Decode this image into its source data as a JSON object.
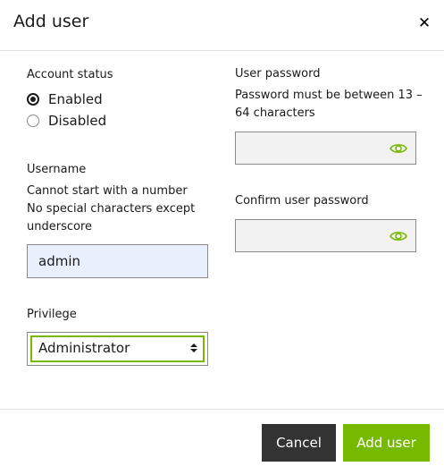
{
  "dialog": {
    "title": "Add user",
    "close_glyph": "✕"
  },
  "account_status": {
    "label": "Account status",
    "options": [
      {
        "label": "Enabled",
        "selected": true
      },
      {
        "label": "Disabled",
        "selected": false
      }
    ]
  },
  "username": {
    "label": "Username",
    "hints": [
      "Cannot start with a number",
      "No special characters except",
      "underscore"
    ],
    "value": "admin"
  },
  "privilege": {
    "label": "Privilege",
    "selected": "Administrator"
  },
  "password": {
    "label": "User password",
    "hints": [
      "Password must be between 13 –",
      "64 characters"
    ],
    "value": "",
    "icon": "eye-icon"
  },
  "confirm_password": {
    "label": "Confirm user password",
    "value": "",
    "icon": "eye-icon"
  },
  "footer": {
    "cancel_label": "Cancel",
    "add_label": "Add user"
  },
  "colors": {
    "accent": "#76b900",
    "cancel_bg": "#333333",
    "autofill_bg": "#e8f0fe"
  }
}
